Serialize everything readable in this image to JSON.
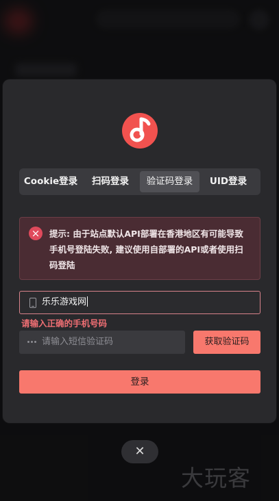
{
  "tabs": [
    {
      "label": "Cookie登录",
      "active": false
    },
    {
      "label": "扫码登录",
      "active": false
    },
    {
      "label": "验证码登录",
      "active": true
    },
    {
      "label": "UID登录",
      "active": false
    }
  ],
  "alert": {
    "icon": "close-circle-icon",
    "text": "提示: 由于站点默认API部署在香港地区有可能导致手机号登陆失败, 建议使用自部署的API或者使用扫码登陆"
  },
  "phone": {
    "icon": "mobile-phone-icon",
    "value": "乐乐游戏网",
    "error": "请输入正确的手机号码"
  },
  "code": {
    "icon": "password-dots-icon",
    "placeholder": "请输入短信验证码",
    "send_label": "获取验证码"
  },
  "login_label": "登录",
  "close": {
    "glyph": "✕",
    "icon": "close-icon"
  },
  "watermark": "大玩客",
  "colors": {
    "accent": "#f8786d",
    "error": "#ee6e73",
    "alert_bg": "#4a2c33",
    "dialog_bg": "#29292c"
  }
}
